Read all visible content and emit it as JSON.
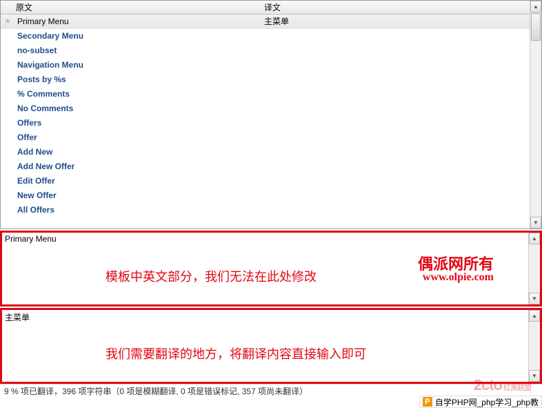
{
  "headers": {
    "source": "原文",
    "target": "译文"
  },
  "rows": [
    {
      "star": true,
      "src": "Primary Menu",
      "tgt": "主菜单",
      "selected": true
    },
    {
      "star": false,
      "src": "Secondary Menu",
      "tgt": ""
    },
    {
      "star": false,
      "src": "no-subset",
      "tgt": ""
    },
    {
      "star": false,
      "src": "Navigation Menu",
      "tgt": ""
    },
    {
      "star": false,
      "src": "Posts by %s",
      "tgt": ""
    },
    {
      "star": false,
      "src": "% Comments",
      "tgt": ""
    },
    {
      "star": false,
      "src": "No Comments",
      "tgt": ""
    },
    {
      "star": false,
      "src": "Offers",
      "tgt": ""
    },
    {
      "star": false,
      "src": "Offer",
      "tgt": ""
    },
    {
      "star": false,
      "src": "Add New",
      "tgt": ""
    },
    {
      "star": false,
      "src": "Add New Offer",
      "tgt": ""
    },
    {
      "star": false,
      "src": "Edit Offer",
      "tgt": ""
    },
    {
      "star": false,
      "src": "New Offer",
      "tgt": ""
    },
    {
      "star": false,
      "src": "All Offers",
      "tgt": ""
    }
  ],
  "source_pane": {
    "label": "Primary Menu",
    "annotation": "模板中英文部分，我们无法在此处修改",
    "brand_name": "偶派网所有",
    "brand_url": "www.olpie.com"
  },
  "target_pane": {
    "label": "主菜单",
    "annotation": "我们需要翻译的地方，将翻译内容直接输入即可"
  },
  "status_text": "9 % 项已翻译，396 项字符串（0 项是模糊翻译, 0 项是错误标记, 357 项尚未翻译）",
  "watermark": {
    "logo": "2cto",
    "cn": "红黑联盟"
  },
  "adbar": {
    "icon": "P",
    "text": "自学PHP网_php学习_php教"
  }
}
